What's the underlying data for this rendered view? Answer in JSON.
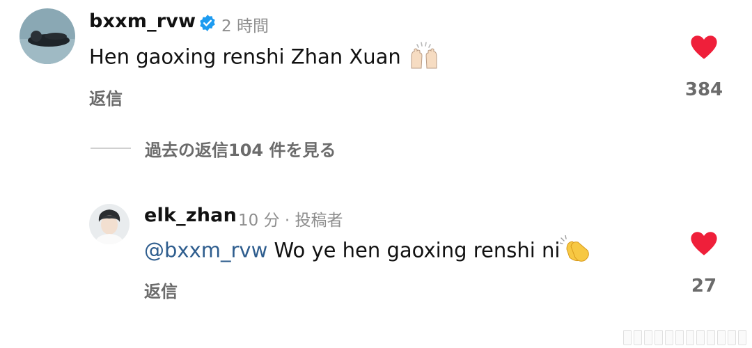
{
  "comments": [
    {
      "username": "bxxm_rvw",
      "verified": true,
      "time": "2 時間",
      "text": "Hen gaoxing renshi Zhan Xuan",
      "emoji": "raising-hands",
      "reply_label": "返信",
      "like_count": "384"
    },
    {
      "username": "elk_zhan",
      "time": "10 分 · 投稿者",
      "mention": "@bxxm_rvw",
      "text": " Wo ye hen gaoxing renshi ni",
      "emoji": "clapping-hands",
      "reply_label": "返信",
      "like_count": "27"
    }
  ],
  "view_replies_label": "過去の返信104 件を見る",
  "colors": {
    "heart": "#ef1f3a",
    "mention": "#2e5d8e",
    "verified": "#1d9bf0",
    "muted": "#8e8e8e"
  },
  "icons": [
    "verified-badge-icon",
    "heart-icon",
    "raising-hands-emoji",
    "clapping-hands-emoji"
  ]
}
